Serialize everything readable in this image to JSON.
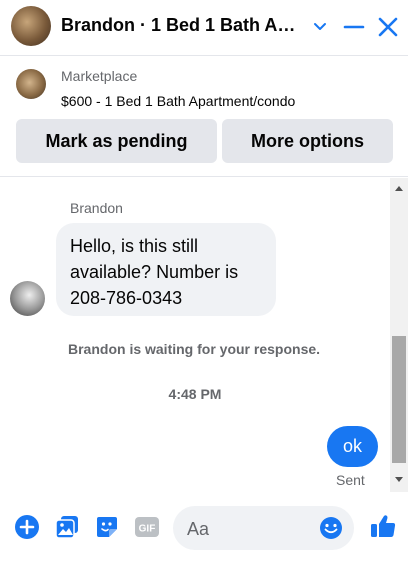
{
  "header": {
    "title": "Brandon · 1 Bed 1 Bath Ap...",
    "buttons": [
      "chevron-down-icon",
      "minimize-icon",
      "close-icon"
    ]
  },
  "listing": {
    "source": "Marketplace",
    "title": "$600 - 1 Bed 1 Bath Apartment/condo",
    "mark_pending_label": "Mark as pending",
    "more_options_label": "More options"
  },
  "conversation": {
    "sender_name": "Brandon",
    "incoming_lines": [
      "Hello, is this still",
      "available? Number is",
      "208-786-0343"
    ],
    "status_text": "Brandon is waiting for your response.",
    "timestamp": "4:48 PM",
    "outgoing_text": "ok",
    "outgoing_status": "Sent"
  },
  "composer": {
    "placeholder": "Aa",
    "icons": [
      "plus-circle-icon",
      "photo-icon",
      "sticker-icon",
      "gif-icon",
      "emoji-icon",
      "thumbs-up-icon"
    ]
  },
  "colors": {
    "accent": "#1877f2",
    "bubble_in": "#f0f2f5",
    "button_bg": "#e4e6eb",
    "secondary_text": "#65676b"
  }
}
